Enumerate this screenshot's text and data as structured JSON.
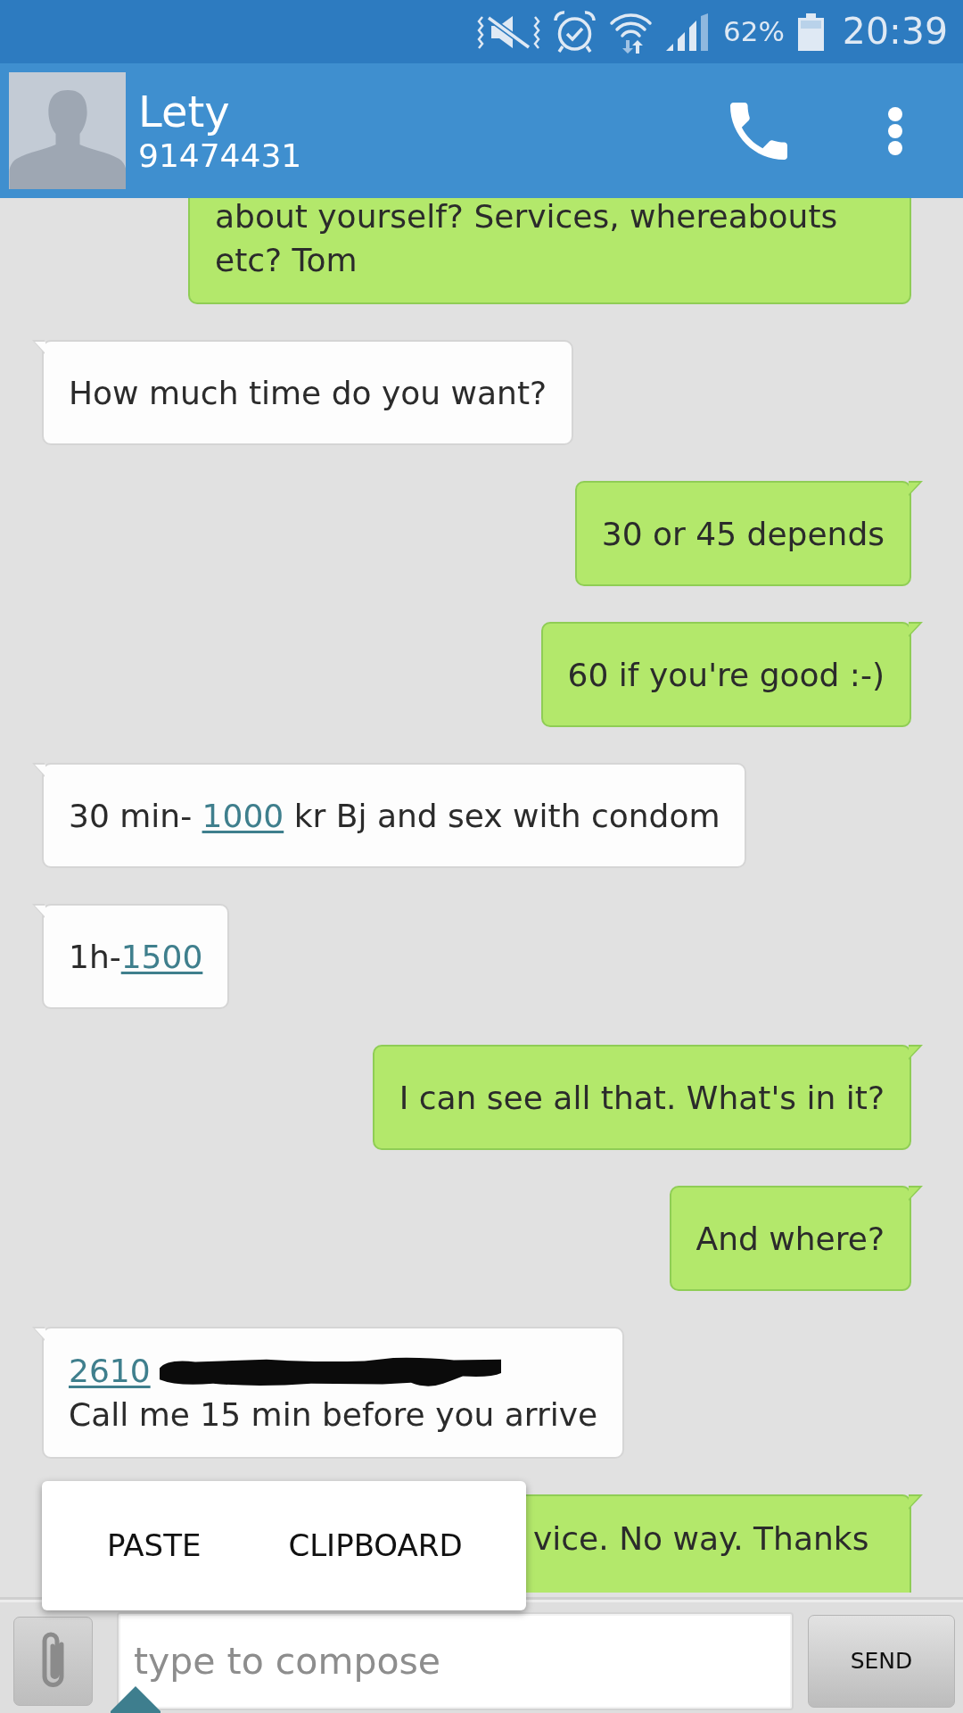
{
  "status_bar": {
    "battery": "62%",
    "time": "20:39"
  },
  "contact": {
    "name": "Lety",
    "number": "91474431"
  },
  "messages": [
    {
      "kind": "outgoing",
      "parts": [
        {
          "kind": "text",
          "text": "about yourself? Services, whereabouts etc? Tom"
        }
      ]
    },
    {
      "kind": "incoming",
      "parts": [
        {
          "kind": "text",
          "text": "How much time do you want?"
        }
      ]
    },
    {
      "kind": "outgoing",
      "parts": [
        {
          "kind": "text",
          "text": "30 or 45 depends"
        }
      ]
    },
    {
      "kind": "outgoing",
      "parts": [
        {
          "kind": "text",
          "text": "60 if you're good :-)"
        }
      ]
    },
    {
      "kind": "incoming",
      "parts": [
        {
          "kind": "text",
          "text": "30 min- "
        },
        {
          "kind": "link",
          "text": "1000"
        },
        {
          "kind": "text",
          "text": " kr Bj and sex with condom"
        }
      ]
    },
    {
      "kind": "incoming",
      "parts": [
        {
          "kind": "text",
          "text": "1h-"
        },
        {
          "kind": "link",
          "text": "1500"
        }
      ]
    },
    {
      "kind": "outgoing",
      "parts": [
        {
          "kind": "text",
          "text": "I can see all that. What's in it?"
        }
      ]
    },
    {
      "kind": "outgoing",
      "parts": [
        {
          "kind": "text",
          "text": "And where?"
        }
      ]
    },
    {
      "kind": "incoming",
      "parts": [
        {
          "kind": "link",
          "text": "2610"
        },
        {
          "kind": "redacted"
        },
        {
          "kind": "break"
        },
        {
          "kind": "text",
          "text": "Call me 15 min before you arrive"
        }
      ]
    },
    {
      "kind": "outgoing",
      "parts": [
        {
          "kind": "text",
          "text": "vice. No way. Thanks"
        }
      ]
    }
  ],
  "context_menu": {
    "items": [
      "PASTE",
      "CLIPBOARD"
    ]
  },
  "composer": {
    "placeholder": "type to compose",
    "send": "SEND"
  }
}
